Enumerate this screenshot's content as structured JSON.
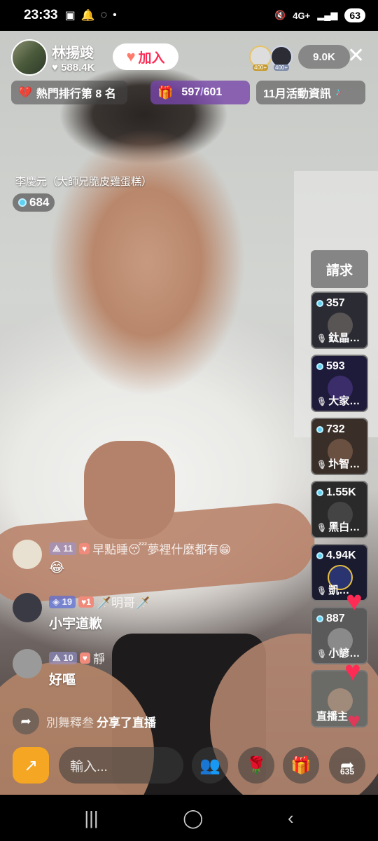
{
  "status_bar": {
    "time": "23:33",
    "battery": "63",
    "network": "4G+"
  },
  "host": {
    "name": "林揚竣",
    "likes": "588.4K",
    "join_label": "加入"
  },
  "viewers": {
    "badge_1": "400+",
    "badge_2": "400+",
    "count": "9.0K"
  },
  "rank": {
    "label": "熱門排行第 8 名"
  },
  "goal": {
    "current": "597",
    "separator": "/",
    "total": "601"
  },
  "event": {
    "label": "11月活動資訊"
  },
  "guest": {
    "label": "李慶元（大師兄脆皮雞蛋糕）",
    "count": "684"
  },
  "request_label": "請求",
  "guest_slots": [
    {
      "count": "357",
      "name": "鈦晶…"
    },
    {
      "count": "593",
      "name": "大家…"
    },
    {
      "count": "732",
      "name": "圤智…"
    },
    {
      "count": "1.55K",
      "name": "黑白…"
    },
    {
      "count": "4.94K",
      "name": "凱…"
    },
    {
      "count": "887",
      "name": "小諺…"
    },
    {
      "name": "直播主"
    }
  ],
  "chat": [
    {
      "level": "11",
      "username": "早點睡😴夢裡什麼都有😁",
      "message": "😂"
    },
    {
      "level": "19",
      "fan": "1",
      "username": "🗡️明哥🗡️",
      "message": "小宇道歉"
    },
    {
      "level": "10",
      "username": "靜",
      "message": "好嘔"
    }
  ],
  "share": {
    "user": "別舞釋叁",
    "text": "分享了直播"
  },
  "bottom": {
    "input_placeholder": "輸入...",
    "share_count": "635"
  },
  "icons": {
    "close": "close-icon",
    "heart": "heart-icon",
    "diamond": "diamond-icon",
    "gift": "gift-icon",
    "rose": "rose-icon",
    "share": "share-icon"
  },
  "colors": {
    "accent": "#fe2c55",
    "goal_bg": "#7846aa",
    "diamond": "#5fd0f0"
  }
}
